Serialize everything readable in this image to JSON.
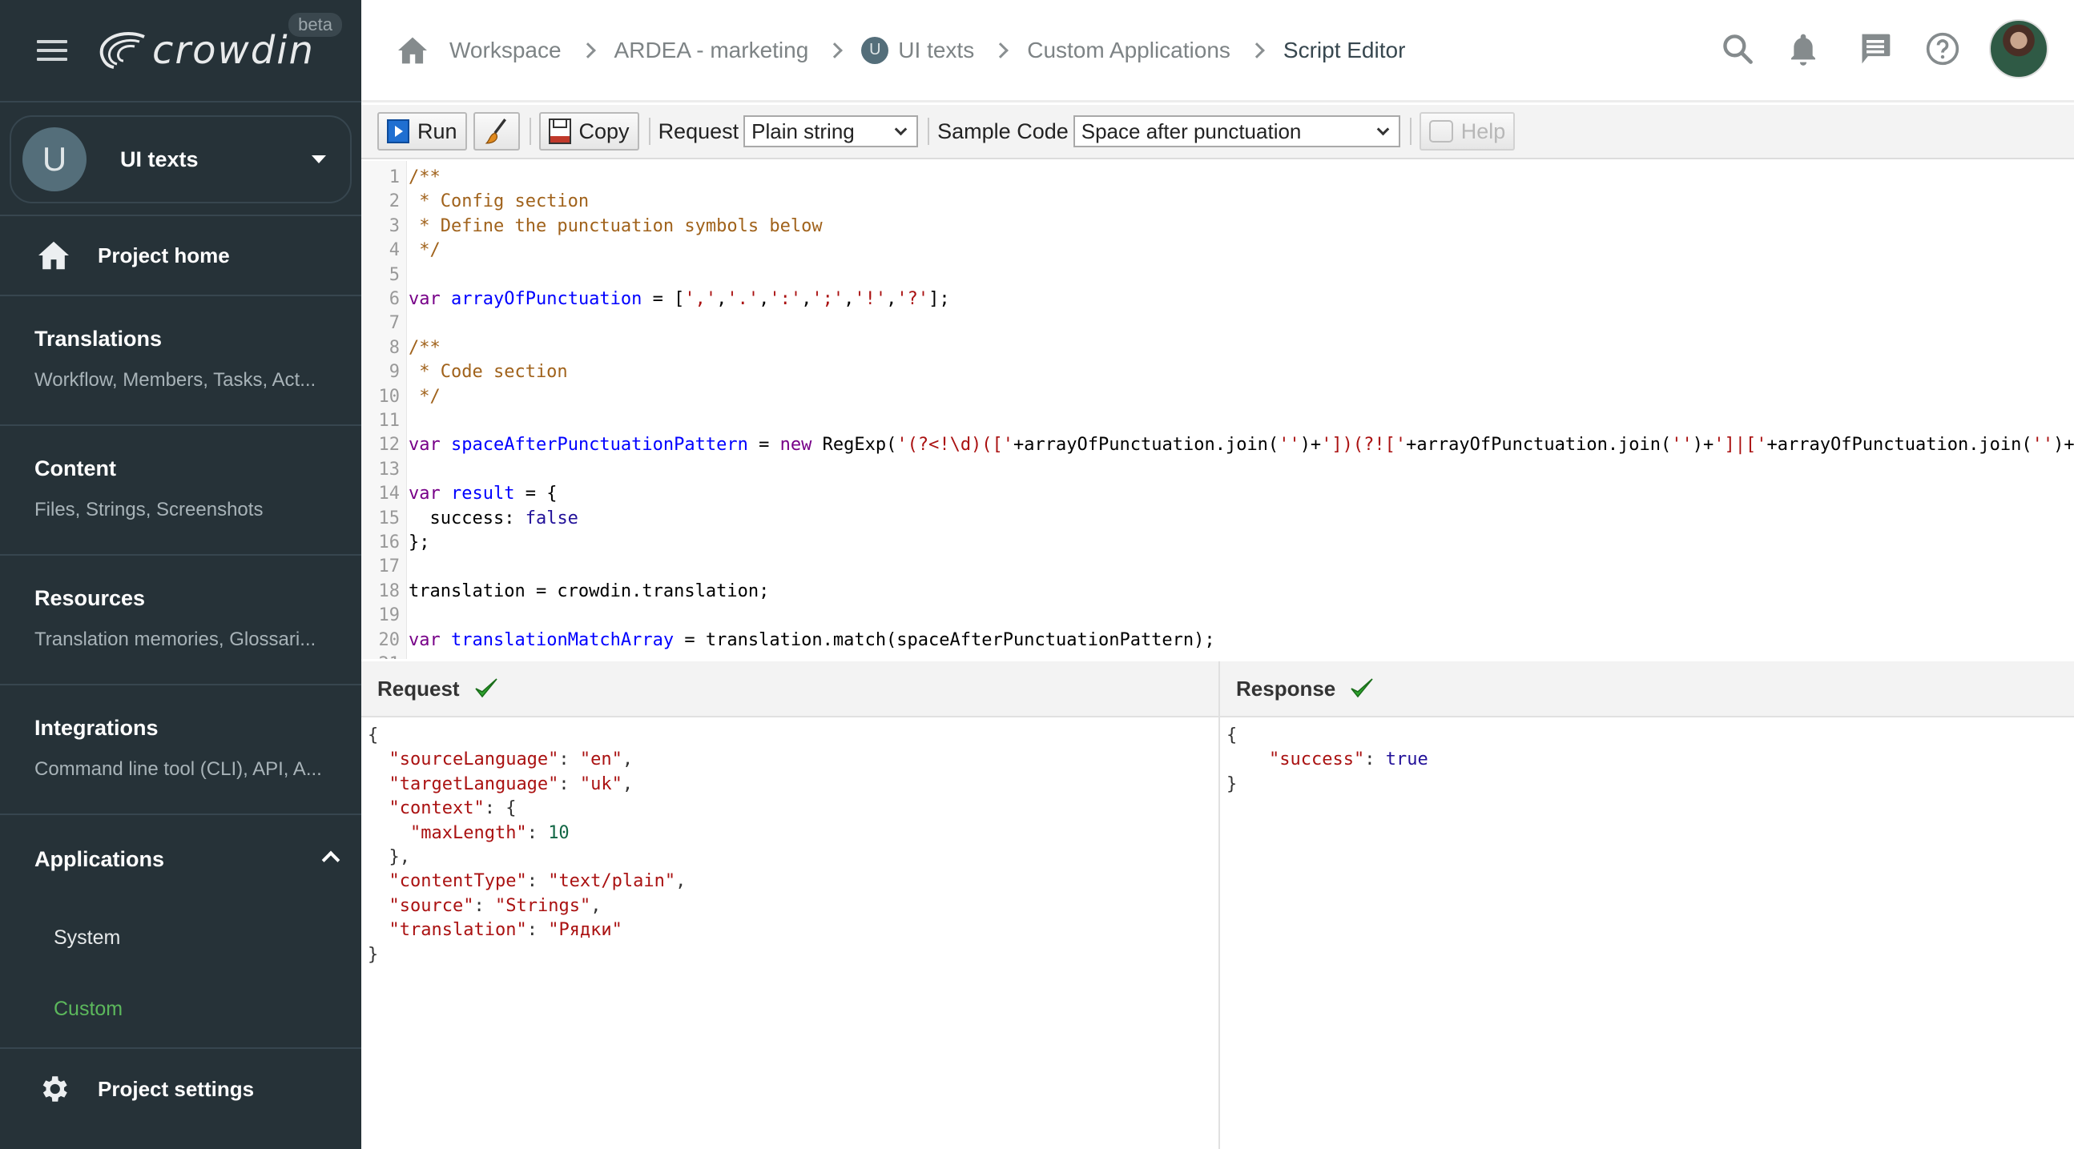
{
  "app": {
    "logo_text": "crowdin",
    "beta_badge": "beta"
  },
  "sidebar": {
    "project": {
      "avatar_letter": "U",
      "name": "UI texts"
    },
    "project_home": "Project home",
    "sections": [
      {
        "title": "Translations",
        "subtitle": "Workflow, Members, Tasks, Act..."
      },
      {
        "title": "Content",
        "subtitle": "Files, Strings, Screenshots"
      },
      {
        "title": "Resources",
        "subtitle": "Translation memories, Glossari..."
      },
      {
        "title": "Integrations",
        "subtitle": "Command line tool (CLI), API, A..."
      }
    ],
    "applications": {
      "title": "Applications",
      "items": [
        "System",
        "Custom"
      ],
      "active": "Custom"
    },
    "project_settings": "Project settings",
    "colors": {
      "background": "#263238",
      "active": "#5cb85c"
    }
  },
  "header": {
    "breadcrumbs": [
      {
        "label": "Workspace"
      },
      {
        "label": "ARDEA - marketing"
      },
      {
        "label": "UI texts",
        "avatar_letter": "U"
      },
      {
        "label": "Custom Applications"
      },
      {
        "label": "Script Editor",
        "current": true
      }
    ],
    "icons": [
      "search-icon",
      "bell-icon",
      "chat-icon",
      "help-icon",
      "user-avatar"
    ]
  },
  "toolbar": {
    "run_label": "Run",
    "copy_label": "Copy",
    "request_label": "Request",
    "request_value": "Plain string",
    "sample_code_label": "Sample Code",
    "sample_code_value": "Space after punctuation",
    "help_label": "Help"
  },
  "editor": {
    "lines": [
      [
        [
          "c-cm",
          "/**"
        ]
      ],
      [
        [
          "c-cm",
          " * Config section"
        ]
      ],
      [
        [
          "c-cm",
          " * Define the punctuation symbols below"
        ]
      ],
      [
        [
          "c-cm",
          " */"
        ]
      ],
      [],
      [
        [
          "c-kw",
          "var"
        ],
        [
          "",
          " "
        ],
        [
          "c-def",
          "arrayOfPunctuation"
        ],
        [
          "",
          " = ["
        ],
        [
          "c-str",
          "','"
        ],
        [
          "",
          ","
        ],
        [
          "c-str",
          "'.'"
        ],
        [
          "",
          ","
        ],
        [
          "c-str",
          "':'"
        ],
        [
          "",
          ","
        ],
        [
          "c-str",
          "';'"
        ],
        [
          "",
          ","
        ],
        [
          "c-str",
          "'!'"
        ],
        [
          "",
          ","
        ],
        [
          "c-str",
          "'?'"
        ],
        [
          "",
          "];"
        ]
      ],
      [],
      [
        [
          "c-cm",
          "/**"
        ]
      ],
      [
        [
          "c-cm",
          " * Code section"
        ]
      ],
      [
        [
          "c-cm",
          " */"
        ]
      ],
      [],
      [
        [
          "c-kw",
          "var"
        ],
        [
          "",
          " "
        ],
        [
          "c-def",
          "spaceAfterPunctuationPattern"
        ],
        [
          "",
          " = "
        ],
        [
          "c-kw",
          "new"
        ],
        [
          "",
          " RegExp("
        ],
        [
          "c-str",
          "'(?<!\\d)(['"
        ],
        [
          "",
          "+arrayOfPunctuation.join("
        ],
        [
          "c-str",
          "''"
        ],
        [
          "",
          ")+"
        ],
        [
          "c-str",
          "'])(?!['"
        ],
        [
          "",
          "+arrayOfPunctuation.join("
        ],
        [
          "c-str",
          "''"
        ],
        [
          "",
          ")+"
        ],
        [
          "c-str",
          "']|['"
        ],
        [
          "",
          "+arrayOfPunctuation.join("
        ],
        [
          "c-str",
          "''"
        ],
        [
          "",
          ")+"
        ]
      ],
      [],
      [
        [
          "c-kw",
          "var"
        ],
        [
          "",
          " "
        ],
        [
          "c-def",
          "result"
        ],
        [
          "",
          " = {"
        ]
      ],
      [
        [
          "",
          "  success: "
        ],
        [
          "c-atom",
          "false"
        ]
      ],
      [
        [
          "",
          "};"
        ]
      ],
      [],
      [
        [
          "",
          "translation = crowdin.translation;"
        ]
      ],
      [],
      [
        [
          "c-kw",
          "var"
        ],
        [
          "",
          " "
        ],
        [
          "c-def",
          "translationMatchArray"
        ],
        [
          "",
          " = translation.match(spaceAfterPunctuationPattern);"
        ]
      ],
      []
    ]
  },
  "request_panel": {
    "title": "Request",
    "status": "success",
    "json": {
      "sourceLanguage": "en",
      "targetLanguage": "uk",
      "context_key": "context",
      "maxLength": 10,
      "contentType": "text/plain",
      "source": "Strings",
      "translation": "Рядки"
    }
  },
  "response_panel": {
    "title": "Response",
    "status": "success",
    "json": {
      "success": "true"
    }
  }
}
